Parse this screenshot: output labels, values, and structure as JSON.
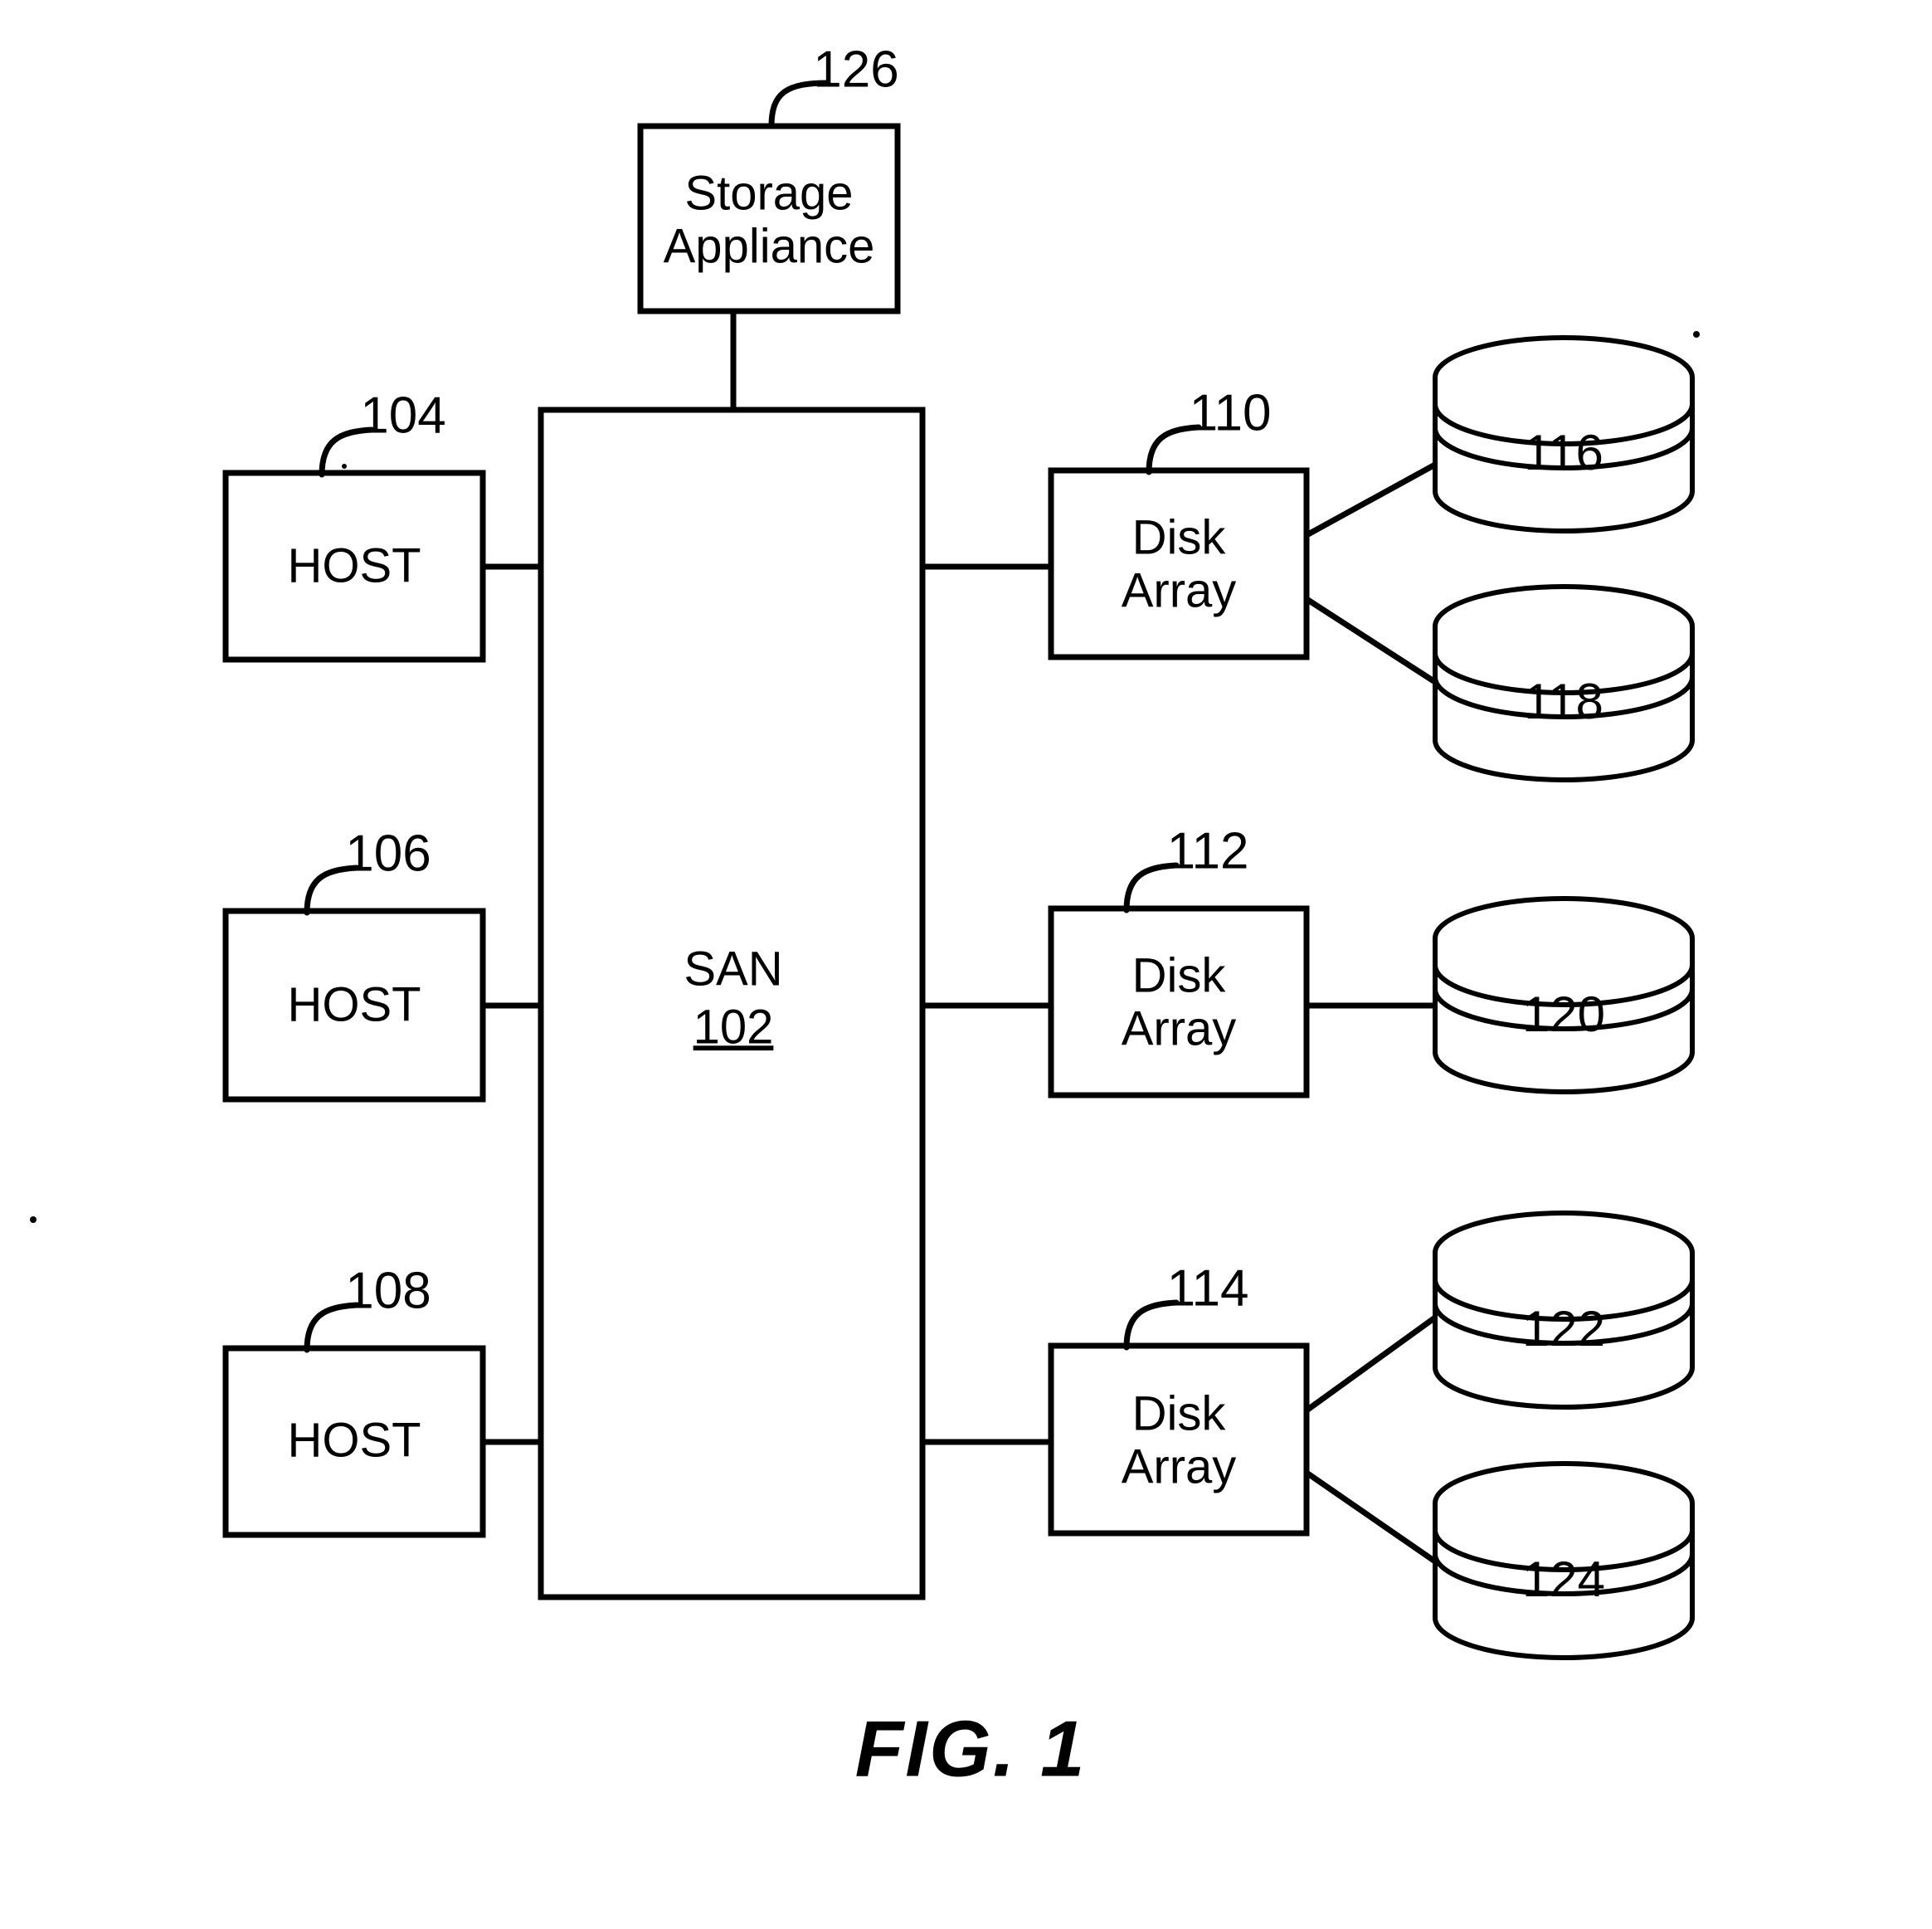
{
  "figure": {
    "caption": "FIG. 1",
    "title": "Storage Area Network block diagram"
  },
  "nodes": {
    "storage_appliance": {
      "label_line1": "Storage",
      "label_line2": "Appliance",
      "ref": "126"
    },
    "san": {
      "label": "SAN",
      "ref": "102"
    },
    "hosts": [
      {
        "label": "HOST",
        "ref": "104"
      },
      {
        "label": "HOST",
        "ref": "106"
      },
      {
        "label": "HOST",
        "ref": "108"
      }
    ],
    "disk_arrays": [
      {
        "label_line1": "Disk",
        "label_line2": "Array",
        "ref": "110"
      },
      {
        "label_line1": "Disk",
        "label_line2": "Array",
        "ref": "112"
      },
      {
        "label_line1": "Disk",
        "label_line2": "Array",
        "ref": "114"
      }
    ],
    "disks": [
      {
        "ref": "116"
      },
      {
        "ref": "118"
      },
      {
        "ref": "120"
      },
      {
        "ref": "122"
      },
      {
        "ref": "124"
      }
    ]
  },
  "colors": {
    "ink": "#000000",
    "paper": "#ffffff"
  }
}
